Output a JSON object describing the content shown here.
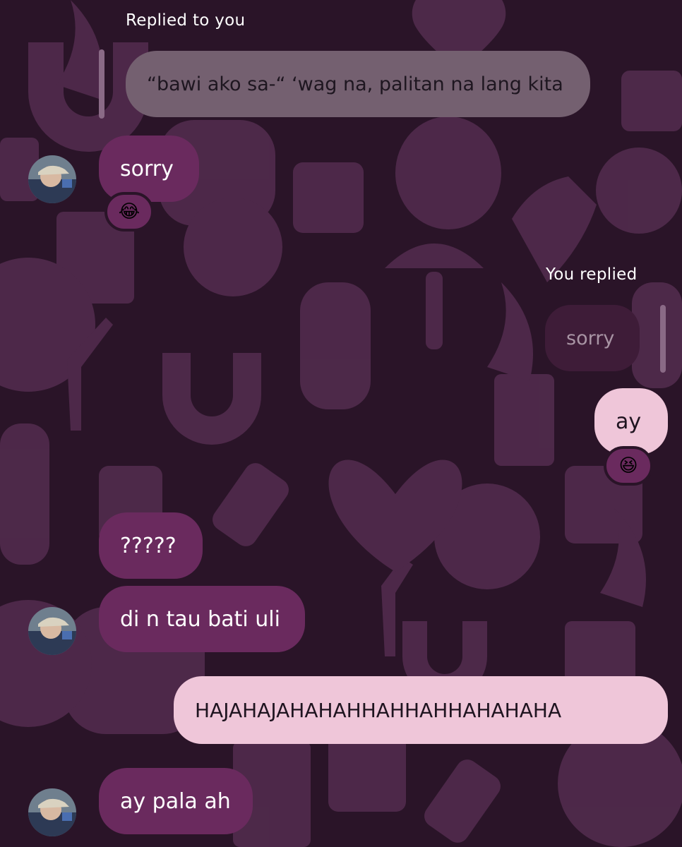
{
  "theme": {
    "background": "#2a1428",
    "incoming_bubble": "#6a2a5e",
    "outgoing_bubble": "#efc6d9",
    "quoted_incoming": "#746070",
    "quoted_outgoing": "#3e1c38"
  },
  "messages": {
    "reply_label_them": "Replied to you",
    "quote_them": "“bawi ako sa-“ ‘wag na, palitan na lang kita",
    "msg_sorry": "sorry",
    "reaction_sorry": "😂",
    "reply_label_mine": "You replied",
    "quote_mine": "sorry",
    "msg_ay": "ay",
    "reaction_ay": "😆",
    "msg_question": "?????",
    "msg_bati": "di n tau bati uli",
    "msg_haha": "HAJAHAJAHAHAHHAHHAHHAHAHAHA",
    "msg_aypala": "ay pala ah"
  },
  "icons": {
    "avatar": "user-avatar-icon",
    "pattern": [
      "horseshoe-icon",
      "dice-icon",
      "clover-icon",
      "mushroom-icon",
      "heart-icon",
      "key-icon",
      "eight-ball-icon",
      "wishbone-icon",
      "playing-card-icon",
      "lucky-cat-icon"
    ]
  }
}
